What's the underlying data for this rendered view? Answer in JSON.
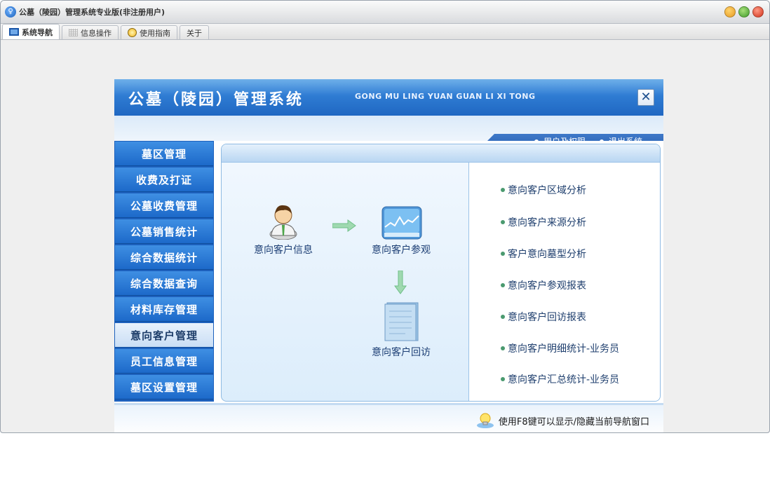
{
  "window": {
    "title": "公墓（陵园）管理系统专业版(非注册用户)"
  },
  "tabs": [
    {
      "label": "系统导航"
    },
    {
      "label": "信息操作"
    },
    {
      "label": "使用指南"
    },
    {
      "label": "关于"
    }
  ],
  "panel": {
    "title": "公墓（陵园）管理系统",
    "subtitle": "GONG MU LING YUAN GUAN LI XI TONG",
    "close": "✕",
    "links": [
      {
        "label": "用户及权限"
      },
      {
        "label": "退出系统"
      }
    ]
  },
  "sidebar": {
    "items": [
      {
        "label": "墓区管理"
      },
      {
        "label": "收费及打证"
      },
      {
        "label": "公墓收费管理"
      },
      {
        "label": "公墓销售统计"
      },
      {
        "label": "综合数据统计"
      },
      {
        "label": "综合数据查询"
      },
      {
        "label": "材料库存管理"
      },
      {
        "label": "意向客户管理"
      },
      {
        "label": "员工信息管理"
      },
      {
        "label": "墓区设置管理"
      }
    ],
    "active_index": 7
  },
  "flow": {
    "customer_info": "意向客户信息",
    "visit": "意向客户参观",
    "revisit": "意向客户回访"
  },
  "analyses": [
    {
      "label": "意向客户区域分析"
    },
    {
      "label": "意向客户来源分析"
    },
    {
      "label": "客户意向墓型分析"
    },
    {
      "label": "意向客户参观报表"
    },
    {
      "label": "意向客户回访报表"
    },
    {
      "label": "意向客户明细统计-业务员"
    },
    {
      "label": "意向客户汇总统计-业务员"
    }
  ],
  "footer": {
    "hint": "使用F8键可以显示/隐藏当前导航窗口"
  },
  "colors": {
    "accent": "#1d61bd",
    "close_red": "#e2452c",
    "min_yellow": "#f0b53c",
    "max_green": "#5cb544"
  }
}
